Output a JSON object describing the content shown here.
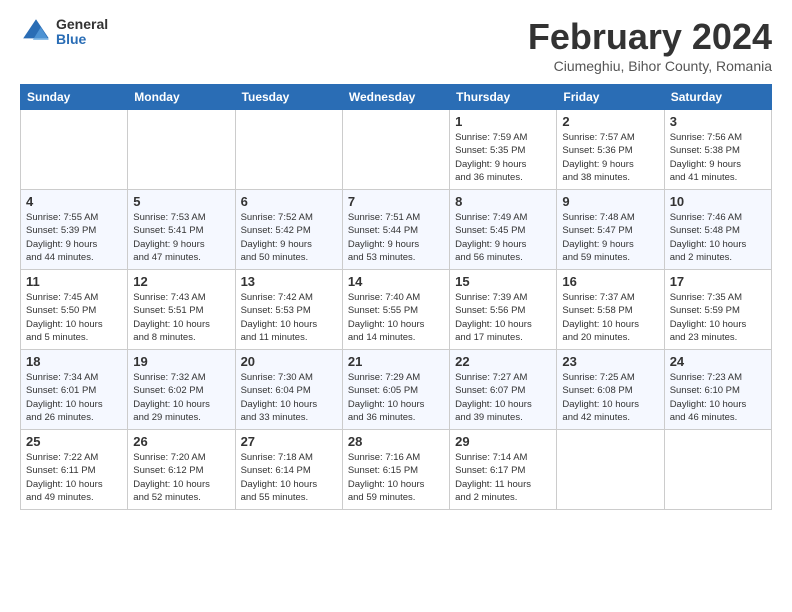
{
  "header": {
    "logo_general": "General",
    "logo_blue": "Blue",
    "title": "February 2024",
    "subtitle": "Ciumeghiu, Bihor County, Romania"
  },
  "columns": [
    "Sunday",
    "Monday",
    "Tuesday",
    "Wednesday",
    "Thursday",
    "Friday",
    "Saturday"
  ],
  "weeks": [
    {
      "days": [
        {
          "num": "",
          "info": ""
        },
        {
          "num": "",
          "info": ""
        },
        {
          "num": "",
          "info": ""
        },
        {
          "num": "",
          "info": ""
        },
        {
          "num": "1",
          "info": "Sunrise: 7:59 AM\nSunset: 5:35 PM\nDaylight: 9 hours\nand 36 minutes."
        },
        {
          "num": "2",
          "info": "Sunrise: 7:57 AM\nSunset: 5:36 PM\nDaylight: 9 hours\nand 38 minutes."
        },
        {
          "num": "3",
          "info": "Sunrise: 7:56 AM\nSunset: 5:38 PM\nDaylight: 9 hours\nand 41 minutes."
        }
      ]
    },
    {
      "days": [
        {
          "num": "4",
          "info": "Sunrise: 7:55 AM\nSunset: 5:39 PM\nDaylight: 9 hours\nand 44 minutes."
        },
        {
          "num": "5",
          "info": "Sunrise: 7:53 AM\nSunset: 5:41 PM\nDaylight: 9 hours\nand 47 minutes."
        },
        {
          "num": "6",
          "info": "Sunrise: 7:52 AM\nSunset: 5:42 PM\nDaylight: 9 hours\nand 50 minutes."
        },
        {
          "num": "7",
          "info": "Sunrise: 7:51 AM\nSunset: 5:44 PM\nDaylight: 9 hours\nand 53 minutes."
        },
        {
          "num": "8",
          "info": "Sunrise: 7:49 AM\nSunset: 5:45 PM\nDaylight: 9 hours\nand 56 minutes."
        },
        {
          "num": "9",
          "info": "Sunrise: 7:48 AM\nSunset: 5:47 PM\nDaylight: 9 hours\nand 59 minutes."
        },
        {
          "num": "10",
          "info": "Sunrise: 7:46 AM\nSunset: 5:48 PM\nDaylight: 10 hours\nand 2 minutes."
        }
      ]
    },
    {
      "days": [
        {
          "num": "11",
          "info": "Sunrise: 7:45 AM\nSunset: 5:50 PM\nDaylight: 10 hours\nand 5 minutes."
        },
        {
          "num": "12",
          "info": "Sunrise: 7:43 AM\nSunset: 5:51 PM\nDaylight: 10 hours\nand 8 minutes."
        },
        {
          "num": "13",
          "info": "Sunrise: 7:42 AM\nSunset: 5:53 PM\nDaylight: 10 hours\nand 11 minutes."
        },
        {
          "num": "14",
          "info": "Sunrise: 7:40 AM\nSunset: 5:55 PM\nDaylight: 10 hours\nand 14 minutes."
        },
        {
          "num": "15",
          "info": "Sunrise: 7:39 AM\nSunset: 5:56 PM\nDaylight: 10 hours\nand 17 minutes."
        },
        {
          "num": "16",
          "info": "Sunrise: 7:37 AM\nSunset: 5:58 PM\nDaylight: 10 hours\nand 20 minutes."
        },
        {
          "num": "17",
          "info": "Sunrise: 7:35 AM\nSunset: 5:59 PM\nDaylight: 10 hours\nand 23 minutes."
        }
      ]
    },
    {
      "days": [
        {
          "num": "18",
          "info": "Sunrise: 7:34 AM\nSunset: 6:01 PM\nDaylight: 10 hours\nand 26 minutes."
        },
        {
          "num": "19",
          "info": "Sunrise: 7:32 AM\nSunset: 6:02 PM\nDaylight: 10 hours\nand 29 minutes."
        },
        {
          "num": "20",
          "info": "Sunrise: 7:30 AM\nSunset: 6:04 PM\nDaylight: 10 hours\nand 33 minutes."
        },
        {
          "num": "21",
          "info": "Sunrise: 7:29 AM\nSunset: 6:05 PM\nDaylight: 10 hours\nand 36 minutes."
        },
        {
          "num": "22",
          "info": "Sunrise: 7:27 AM\nSunset: 6:07 PM\nDaylight: 10 hours\nand 39 minutes."
        },
        {
          "num": "23",
          "info": "Sunrise: 7:25 AM\nSunset: 6:08 PM\nDaylight: 10 hours\nand 42 minutes."
        },
        {
          "num": "24",
          "info": "Sunrise: 7:23 AM\nSunset: 6:10 PM\nDaylight: 10 hours\nand 46 minutes."
        }
      ]
    },
    {
      "days": [
        {
          "num": "25",
          "info": "Sunrise: 7:22 AM\nSunset: 6:11 PM\nDaylight: 10 hours\nand 49 minutes."
        },
        {
          "num": "26",
          "info": "Sunrise: 7:20 AM\nSunset: 6:12 PM\nDaylight: 10 hours\nand 52 minutes."
        },
        {
          "num": "27",
          "info": "Sunrise: 7:18 AM\nSunset: 6:14 PM\nDaylight: 10 hours\nand 55 minutes."
        },
        {
          "num": "28",
          "info": "Sunrise: 7:16 AM\nSunset: 6:15 PM\nDaylight: 10 hours\nand 59 minutes."
        },
        {
          "num": "29",
          "info": "Sunrise: 7:14 AM\nSunset: 6:17 PM\nDaylight: 11 hours\nand 2 minutes."
        },
        {
          "num": "",
          "info": ""
        },
        {
          "num": "",
          "info": ""
        }
      ]
    }
  ]
}
